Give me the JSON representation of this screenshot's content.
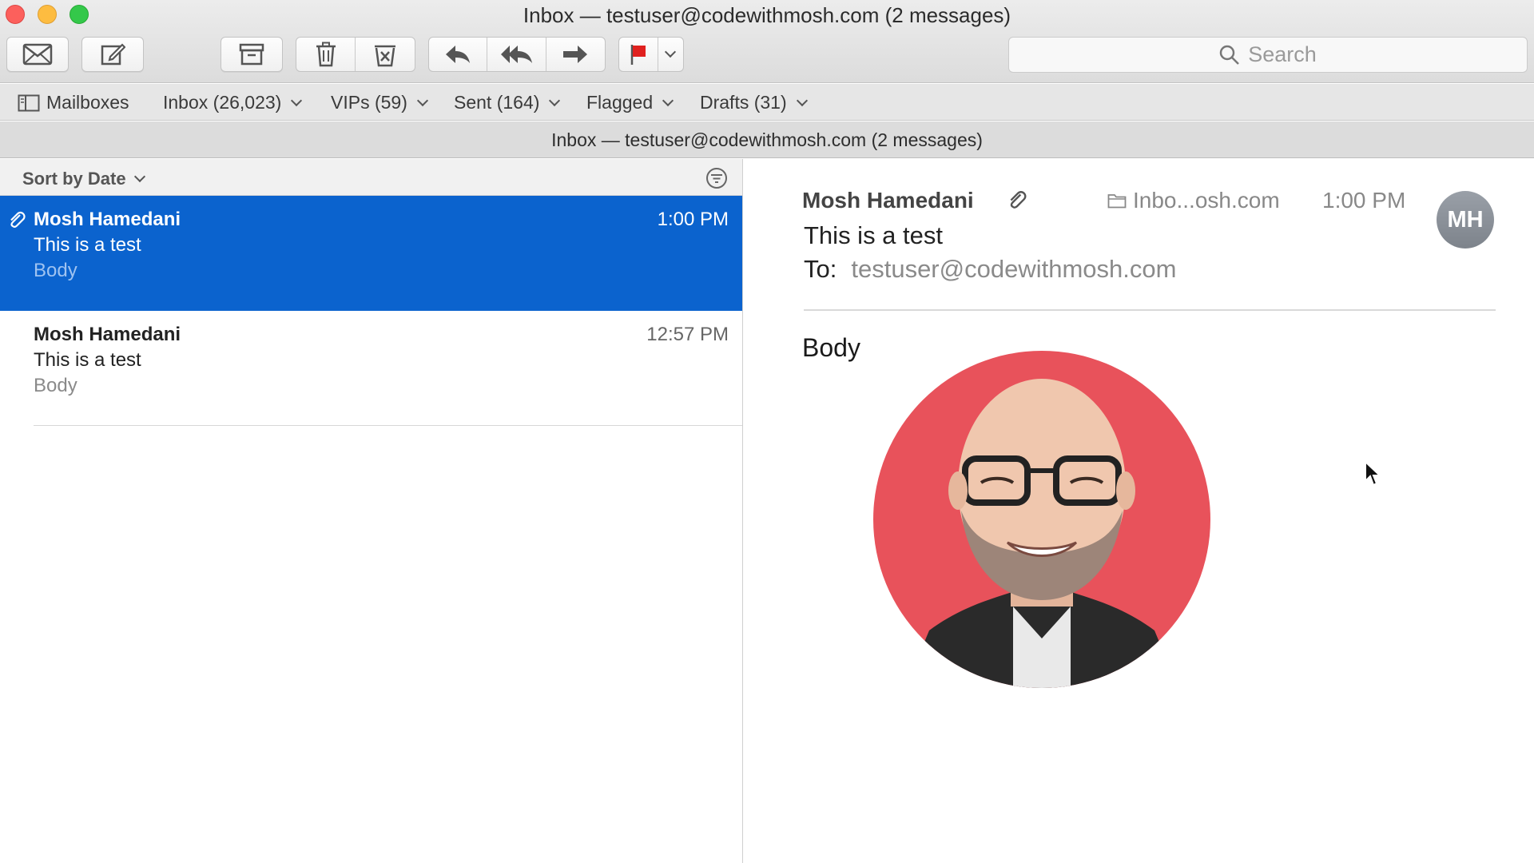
{
  "window": {
    "title": "Inbox — testuser@codewithmosh.com (2 messages)"
  },
  "toolbar": {
    "buttons": [
      {
        "name": "get-mail",
        "icon": "envelope-icon"
      },
      {
        "name": "compose",
        "icon": "compose-icon"
      },
      {
        "name": "archive",
        "icon": "archive-icon"
      },
      {
        "name": "delete",
        "icon": "trash-icon"
      },
      {
        "name": "junk",
        "icon": "junk-icon"
      },
      {
        "name": "reply",
        "icon": "reply-icon"
      },
      {
        "name": "reply-all",
        "icon": "reply-all-icon"
      },
      {
        "name": "forward",
        "icon": "forward-icon"
      },
      {
        "name": "flag",
        "icon": "flag-icon",
        "color": "#e0211f"
      },
      {
        "name": "flag-menu",
        "icon": "chevron-down-icon"
      }
    ],
    "search_placeholder": "Search"
  },
  "favorites": {
    "mailboxes_label": "Mailboxes",
    "items": [
      {
        "label": "Inbox (26,023)"
      },
      {
        "label": "VIPs (59)"
      },
      {
        "label": "Sent (164)"
      },
      {
        "label": "Flagged"
      },
      {
        "label": "Drafts (31)"
      }
    ]
  },
  "subtitle": "Inbox — testuser@codewithmosh.com (2 messages)",
  "list": {
    "sort_label": "Sort by Date",
    "messages": [
      {
        "from": "Mosh Hamedani",
        "time": "1:00 PM",
        "subject": "This is a test",
        "preview": "Body",
        "selected": true,
        "has_attachment": true
      },
      {
        "from": "Mosh Hamedani",
        "time": "12:57 PM",
        "subject": "This is a test",
        "preview": "Body",
        "selected": false,
        "has_attachment": false
      }
    ]
  },
  "reader": {
    "from": "Mosh Hamedani",
    "mailbox": "Inbo...osh.com",
    "time": "1:00 PM",
    "avatar_initials": "MH",
    "subject": "This is a test",
    "to_label": "To:",
    "to_address": "testuser@codewithmosh.com",
    "body": "Body"
  },
  "colors": {
    "selection": "#0b63ce",
    "flag": "#e0211f",
    "photo_bg": "#e8525b"
  }
}
